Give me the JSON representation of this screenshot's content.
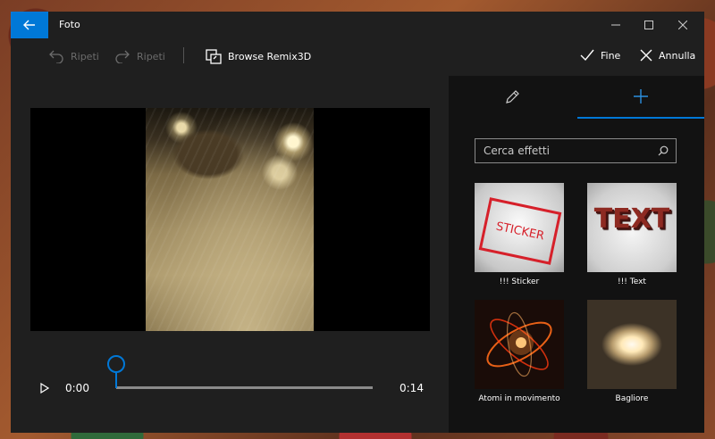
{
  "window": {
    "title": "Foto"
  },
  "toolbar": {
    "undo_label": "Ripeti",
    "redo_label": "Ripeti",
    "browse_label": "Browse Remix3D",
    "done_label": "Fine",
    "cancel_label": "Annulla"
  },
  "timeline": {
    "current_time": "0:00",
    "total_time": "0:14",
    "progress": 0
  },
  "panel": {
    "search_placeholder": "Cerca effetti",
    "active_tab": "add",
    "effects": [
      {
        "label": "!!! Sticker",
        "thumb_text": "STICKER"
      },
      {
        "label": "!!! Text",
        "thumb_text": "TEXT"
      },
      {
        "label": "Atomi in movimento"
      },
      {
        "label": "Bagliore"
      }
    ]
  },
  "colors": {
    "accent": "#0078d7",
    "window_bg": "#1f1f1f",
    "panel_bg": "#121212"
  }
}
